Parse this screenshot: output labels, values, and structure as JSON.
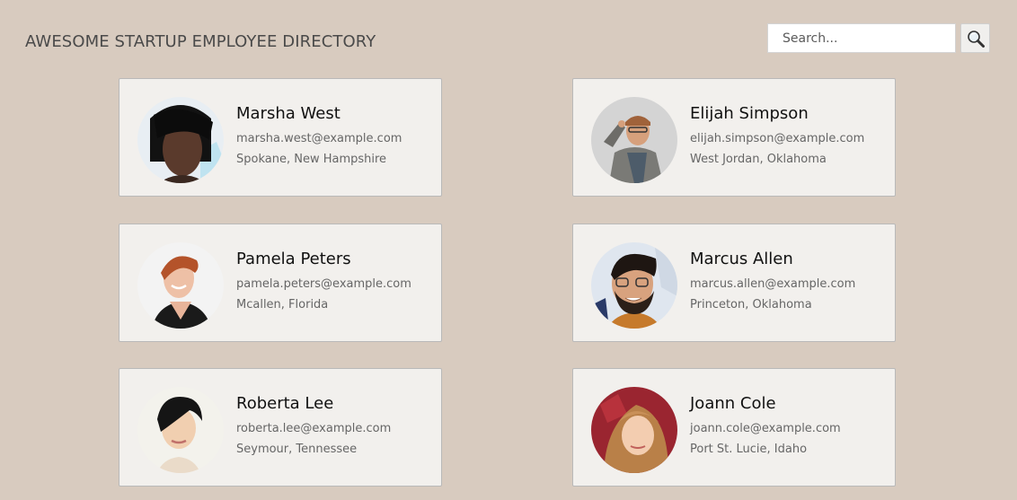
{
  "header": {
    "title": "AWESOME STARTUP EMPLOYEE DIRECTORY"
  },
  "search": {
    "placeholder": "Search...",
    "value": "",
    "button_icon": "magnifier-icon"
  },
  "employees": [
    {
      "name": "Marsha West",
      "email": "marsha.west@example.com",
      "location": "Spokane, New Hampshire"
    },
    {
      "name": "Elijah Simpson",
      "email": "elijah.simpson@example.com",
      "location": "West Jordan, Oklahoma"
    },
    {
      "name": "Pamela Peters",
      "email": "pamela.peters@example.com",
      "location": "Mcallen, Florida"
    },
    {
      "name": "Marcus Allen",
      "email": "marcus.allen@example.com",
      "location": "Princeton, Oklahoma"
    },
    {
      "name": "Roberta Lee",
      "email": "roberta.lee@example.com",
      "location": "Seymour, Tennessee"
    },
    {
      "name": "Joann Cole",
      "email": "joann.cole@example.com",
      "location": "Port St. Lucie, Idaho"
    }
  ],
  "colors": {
    "background": "#d8cbbf",
    "card": "#f2f0ed",
    "card_border": "#b9b9b9"
  }
}
